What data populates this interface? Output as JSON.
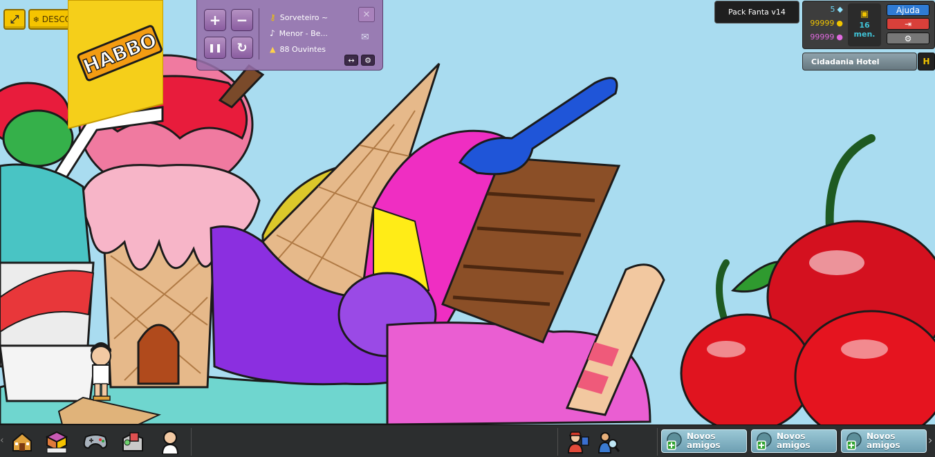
{
  "top_left": {
    "unfreeze_label": "DESCONGELAR",
    "banner_text": "HABBO"
  },
  "radio": {
    "dj": "Sorveteiro ~",
    "song": "Menor - Be...",
    "listeners": "88 Ouvintes"
  },
  "hud": {
    "pack_label": "Pack Fanta v14",
    "diamonds": "5",
    "credits": "99999",
    "duckets": "99999",
    "club_days": "16",
    "club_unit": "men.",
    "help_label": "Ajuda",
    "room_name": "Cidadania Hotel",
    "room_btn": "H"
  },
  "toolbar": {
    "friend_requests": [
      {
        "line1": "Novos",
        "line2": "amigos"
      },
      {
        "line1": "Novos",
        "line2": "amigos"
      },
      {
        "line1": "Novos",
        "line2": "amigos"
      }
    ],
    "more_glyph": "›"
  },
  "colors": {
    "sky": "#a9dcf0",
    "accent_yellow": "#f5c400",
    "radio_purple": "#966eaa",
    "toolbar_bg": "#2c2e2f",
    "friend_blue": "#7fb3c4"
  },
  "icons": [
    "expand-icon",
    "snowflake-icon",
    "plus-icon",
    "minus-icon",
    "pause-icon",
    "refresh-icon",
    "close-icon",
    "music-key-icon",
    "music-note-icon",
    "listeners-icon",
    "mail-icon",
    "swap-icon",
    "settings-icon",
    "diamond-icon",
    "coin-icon",
    "ducket-icon",
    "club-icon",
    "logout-icon",
    "hotel-icon",
    "catalog-icon",
    "games-icon",
    "inventory-icon",
    "avatar-icon",
    "friends-icon",
    "search-friends-icon",
    "add-friend-icon"
  ]
}
